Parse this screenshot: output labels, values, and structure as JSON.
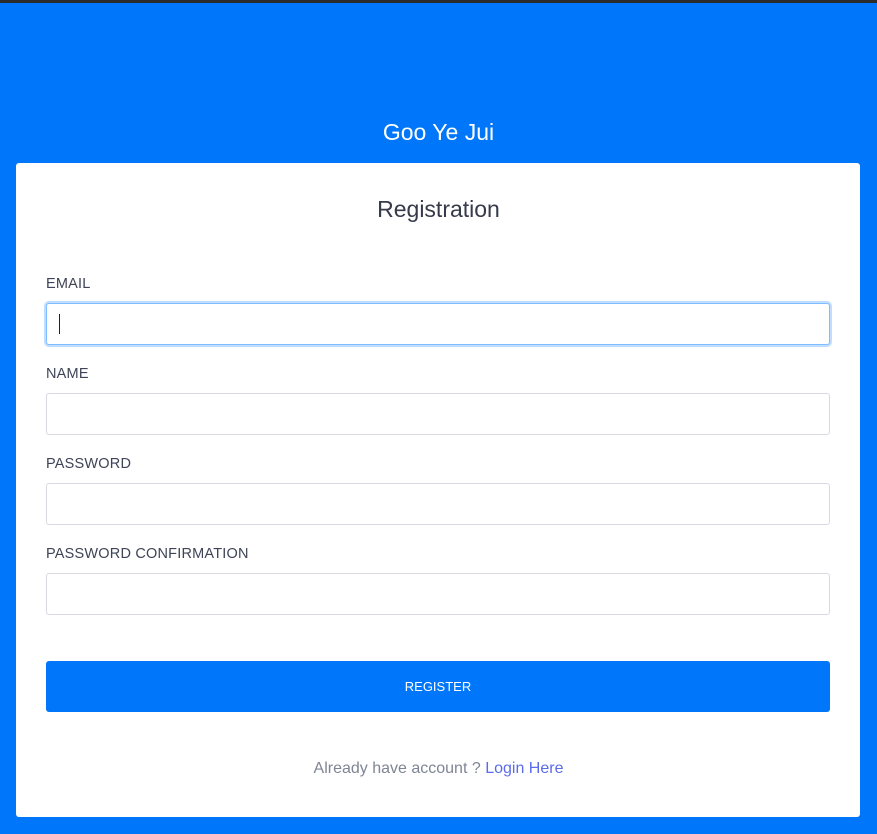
{
  "header": {
    "site_title": "Goo Ye Jui"
  },
  "form": {
    "title": "Registration",
    "fields": [
      {
        "label": "EMAIL",
        "value": "",
        "focused": true
      },
      {
        "label": "NAME",
        "value": ""
      },
      {
        "label": "PASSWORD",
        "value": ""
      },
      {
        "label": "PASSWORD CONFIRMATION",
        "value": ""
      }
    ],
    "submit_label": "REGISTER"
  },
  "footer": {
    "prompt": "Already have account ?",
    "link_label": "Login Here"
  },
  "colors": {
    "background": "#0077FA",
    "button": "#0077FA",
    "link": "#5B6BEA"
  }
}
